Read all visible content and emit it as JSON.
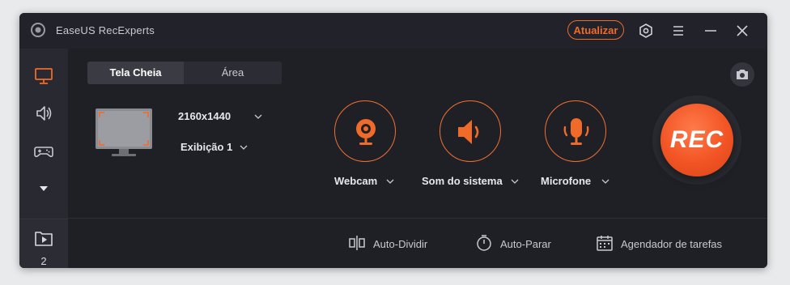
{
  "app": {
    "title": "EaseUS RecExperts",
    "update_label": "Atualizar"
  },
  "titlebar_icons": [
    "settings-hex-icon",
    "menu-icon",
    "minimize-icon",
    "close-icon"
  ],
  "sidebar": {
    "items": [
      {
        "icon": "monitor-icon",
        "active": true
      },
      {
        "icon": "speaker-icon",
        "active": false
      },
      {
        "icon": "gamepad-icon",
        "active": false
      },
      {
        "icon": "more-arrow-icon",
        "active": false
      }
    ],
    "recordings": {
      "icon": "video-folder-icon",
      "count": "2"
    }
  },
  "capture": {
    "tabs": [
      {
        "label": "Tela Cheia",
        "active": true
      },
      {
        "label": "Área",
        "active": false
      }
    ],
    "resolution": "2160x1440",
    "display": "Exibição 1"
  },
  "sources": [
    {
      "label": "Webcam",
      "icon": "webcam-icon"
    },
    {
      "label": "Som do sistema",
      "icon": "speaker-icon"
    },
    {
      "label": "Microfone",
      "icon": "microphone-icon"
    }
  ],
  "rec_label": "REC",
  "bottom_tools": [
    {
      "label": "Auto-Dividir",
      "icon": "split-icon"
    },
    {
      "label": "Auto-Parar",
      "icon": "timer-icon"
    },
    {
      "label": "Agendador de tarefas",
      "icon": "calendar-icon"
    }
  ],
  "colors": {
    "accent": "#f06a2a",
    "background": "#1f2026",
    "sidebar": "#292a31",
    "rec": "#f25424"
  }
}
